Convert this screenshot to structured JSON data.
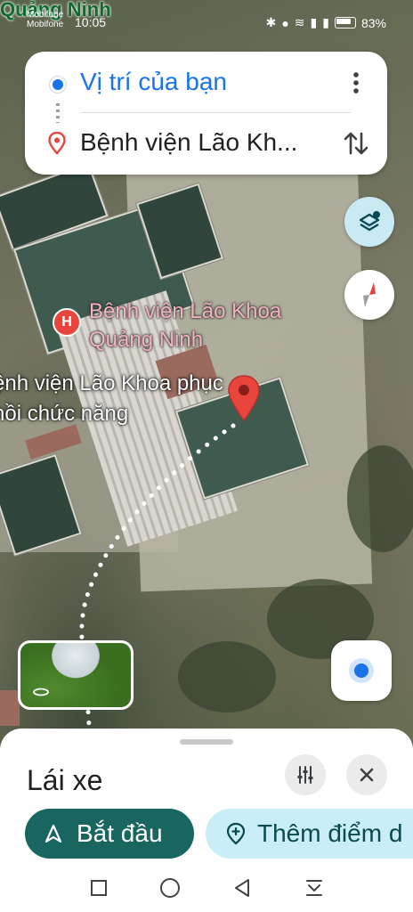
{
  "status_bar": {
    "carrier_1": "Mobifone",
    "carrier_2": "Mobifone",
    "time": "10:05",
    "battery": "83%",
    "overlay_city": "Quảng Ninh"
  },
  "route": {
    "origin": "Vị trí của bạn",
    "destination": "Bệnh viện Lão Kh..."
  },
  "map": {
    "poi_label": "Bệnh viện Lão Khoa Quảng Ninh",
    "poi_badge": "H",
    "destination_label": "ệnh viện Lão Khoa phục hồi chức năng"
  },
  "sheet": {
    "mode": "Lái xe",
    "start_label": "Bắt đầu",
    "add_stop_label": "Thêm điểm d"
  },
  "colors": {
    "accent_blue": "#1a73e8",
    "start_button": "#18665f",
    "pin_red": "#e8453c"
  }
}
